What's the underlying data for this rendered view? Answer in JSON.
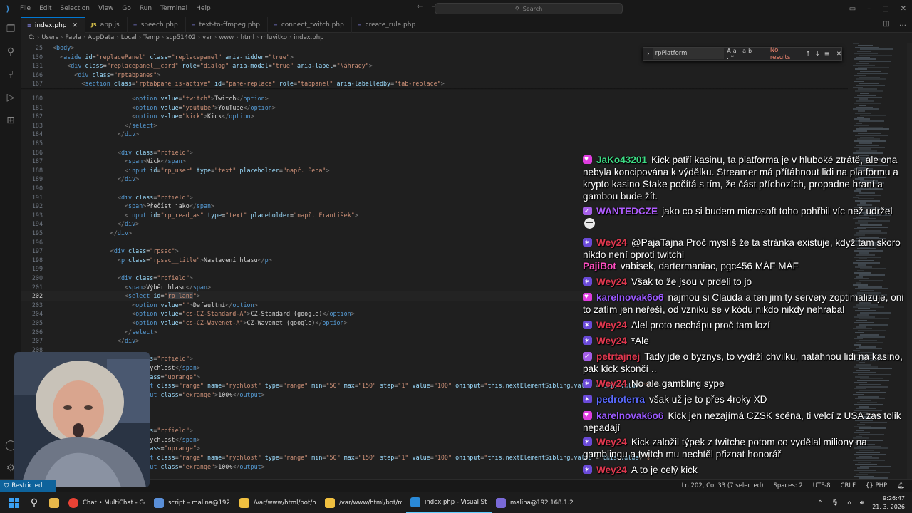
{
  "menu": [
    "File",
    "Edit",
    "Selection",
    "View",
    "Go",
    "Run",
    "Terminal",
    "Help"
  ],
  "search_placeholder": "Search",
  "tabs": [
    {
      "icon": "php",
      "label": "index.php",
      "active": true
    },
    {
      "icon": "js",
      "label": "app.js"
    },
    {
      "icon": "php",
      "label": "speech.php"
    },
    {
      "icon": "php",
      "label": "text-to-ffmpeg.php"
    },
    {
      "icon": "php",
      "label": "connect_twitch.php"
    },
    {
      "icon": "php",
      "label": "create_rule.php"
    }
  ],
  "breadcrumb": [
    "C:",
    "Users",
    "Pavla",
    "AppData",
    "Local",
    "Temp",
    "scp51402",
    "var",
    "www",
    "html",
    "mluvitko",
    "index.php"
  ],
  "find": {
    "query": "rpPlatform",
    "options": "Aa ab .*",
    "result": "No results"
  },
  "sticky": [
    {
      "n": "25",
      "indent": 0,
      "html": "<span class='p'>&lt;</span><span class='t'>body</span><span class='p'>&gt;</span>"
    },
    {
      "n": "130",
      "indent": 1,
      "html": "<span class='p'>&lt;</span><span class='t'>aside</span> <span class='a'>id</span><span class='x'>=</span><span class='s'>\"replacePanel\"</span> <span class='a'>class</span><span class='x'>=</span><span class='s'>\"replacepanel\"</span> <span class='a'>aria-hidden</span><span class='x'>=</span><span class='s'>\"true\"</span><span class='p'>&gt;</span>"
    },
    {
      "n": "131",
      "indent": 2,
      "html": "<span class='p'>&lt;</span><span class='t'>div</span> <span class='a'>class</span><span class='x'>=</span><span class='s'>\"replacepanel__card\"</span> <span class='a'>role</span><span class='x'>=</span><span class='s'>\"dialog\"</span> <span class='a'>aria-modal</span><span class='x'>=</span><span class='s'>\"true\"</span> <span class='a'>aria-label</span><span class='x'>=</span><span class='s'>\"Náhrady\"</span><span class='p'>&gt;</span>"
    },
    {
      "n": "166",
      "indent": 3,
      "html": "<span class='p'>&lt;</span><span class='t'>div</span> <span class='a'>class</span><span class='x'>=</span><span class='s'>\"rptabpanes\"</span><span class='p'>&gt;</span>"
    },
    {
      "n": "167",
      "indent": 4,
      "html": "<span class='p'>&lt;</span><span class='t'>section</span> <span class='a'>class</span><span class='x'>=</span><span class='s'>\"rptabpane is-active\"</span> <span class='a'>id</span><span class='x'>=</span><span class='s'>\"pane-replace\"</span> <span class='a'>role</span><span class='x'>=</span><span class='s'>\"tabpanel\"</span> <span class='a'>aria-labelledby</span><span class='x'>=</span><span class='s'>\"tab-replace\"</span><span class='p'>&gt;</span>"
    }
  ],
  "lines": [
    {
      "n": "180",
      "indent": 11,
      "html": "<span class='p'>&lt;</span><span class='t'>option</span> <span class='a'>value</span><span class='x'>=</span><span class='s'>\"twitch\"</span><span class='p'>&gt;</span><span class='x'>Twitch</span><span class='p'>&lt;/</span><span class='t'>option</span><span class='p'>&gt;</span>"
    },
    {
      "n": "181",
      "indent": 11,
      "html": "<span class='p'>&lt;</span><span class='t'>option</span> <span class='a'>value</span><span class='x'>=</span><span class='s'>\"youtube\"</span><span class='p'>&gt;</span><span class='x'>YouTube</span><span class='p'>&lt;/</span><span class='t'>option</span><span class='p'>&gt;</span>"
    },
    {
      "n": "182",
      "indent": 11,
      "html": "<span class='p'>&lt;</span><span class='t'>option</span> <span class='a'>value</span><span class='x'>=</span><span class='s'>\"kick\"</span><span class='p'>&gt;</span><span class='x'>Kick</span><span class='p'>&lt;/</span><span class='t'>option</span><span class='p'>&gt;</span>"
    },
    {
      "n": "183",
      "indent": 10,
      "html": "<span class='p'>&lt;/</span><span class='t'>select</span><span class='p'>&gt;</span>"
    },
    {
      "n": "184",
      "indent": 9,
      "html": "<span class='p'>&lt;/</span><span class='t'>div</span><span class='p'>&gt;</span>"
    },
    {
      "n": "185",
      "indent": 0,
      "html": ""
    },
    {
      "n": "186",
      "indent": 9,
      "html": "<span class='p'>&lt;</span><span class='t'>div</span> <span class='a'>class</span><span class='x'>=</span><span class='s'>\"rpfield\"</span><span class='p'>&gt;</span>"
    },
    {
      "n": "187",
      "indent": 10,
      "html": "<span class='p'>&lt;</span><span class='t'>span</span><span class='p'>&gt;</span><span class='x'>Nick</span><span class='p'>&lt;/</span><span class='t'>span</span><span class='p'>&gt;</span>"
    },
    {
      "n": "188",
      "indent": 10,
      "html": "<span class='p'>&lt;</span><span class='t'>input</span> <span class='a'>id</span><span class='x'>=</span><span class='s'>\"rp_user\"</span> <span class='a'>type</span><span class='x'>=</span><span class='s'>\"text\"</span> <span class='a'>placeholder</span><span class='x'>=</span><span class='s'>\"např. Pepa\"</span><span class='p'>&gt;</span>"
    },
    {
      "n": "189",
      "indent": 9,
      "html": "<span class='p'>&lt;/</span><span class='t'>div</span><span class='p'>&gt;</span>"
    },
    {
      "n": "190",
      "indent": 0,
      "html": ""
    },
    {
      "n": "191",
      "indent": 9,
      "html": "<span class='p'>&lt;</span><span class='t'>div</span> <span class='a'>class</span><span class='x'>=</span><span class='s'>\"rpfield\"</span><span class='p'>&gt;</span>"
    },
    {
      "n": "192",
      "indent": 10,
      "html": "<span class='p'>&lt;</span><span class='t'>span</span><span class='p'>&gt;</span><span class='x'>Přečíst jako</span><span class='p'>&lt;/</span><span class='t'>span</span><span class='p'>&gt;</span>"
    },
    {
      "n": "193",
      "indent": 10,
      "html": "<span class='p'>&lt;</span><span class='t'>input</span> <span class='a'>id</span><span class='x'>=</span><span class='s'>\"rp_read_as\"</span> <span class='a'>type</span><span class='x'>=</span><span class='s'>\"text\"</span> <span class='a'>placeholder</span><span class='x'>=</span><span class='s'>\"např. František\"</span><span class='p'>&gt;</span>"
    },
    {
      "n": "194",
      "indent": 9,
      "html": "<span class='p'>&lt;/</span><span class='t'>div</span><span class='p'>&gt;</span>"
    },
    {
      "n": "195",
      "indent": 8,
      "html": "<span class='p'>&lt;/</span><span class='t'>div</span><span class='p'>&gt;</span>"
    },
    {
      "n": "196",
      "indent": 0,
      "html": ""
    },
    {
      "n": "197",
      "indent": 8,
      "html": "<span class='p'>&lt;</span><span class='t'>div</span> <span class='a'>class</span><span class='x'>=</span><span class='s'>\"rpsec\"</span><span class='p'>&gt;</span>"
    },
    {
      "n": "198",
      "indent": 9,
      "html": "<span class='p'>&lt;</span><span class='t'>p</span> <span class='a'>class</span><span class='x'>=</span><span class='s'>\"rpsec__title\"</span><span class='p'>&gt;</span><span class='x'>Nastavení hlasu</span><span class='p'>&lt;/</span><span class='t'>p</span><span class='p'>&gt;</span>"
    },
    {
      "n": "199",
      "indent": 0,
      "html": ""
    },
    {
      "n": "200",
      "indent": 9,
      "html": "<span class='p'>&lt;</span><span class='t'>div</span> <span class='a'>class</span><span class='x'>=</span><span class='s'>\"rpfield\"</span><span class='p'>&gt;</span>"
    },
    {
      "n": "201",
      "indent": 10,
      "html": "<span class='p'>&lt;</span><span class='t'>span</span><span class='p'>&gt;</span><span class='x'>Výběr hlasu</span><span class='p'>&lt;/</span><span class='t'>span</span><span class='p'>&gt;</span>"
    },
    {
      "n": "202",
      "indent": 10,
      "cur": true,
      "html": "<span class='p'>&lt;</span><span class='t'>select</span> <span class='a'>id</span><span class='x'>=</span><span class='s'>\"<span class='hl'>rp_lang</span>\"</span><span class='p'>&gt;</span>"
    },
    {
      "n": "203",
      "indent": 11,
      "html": "<span class='p'>&lt;</span><span class='t'>option</span> <span class='a'>value</span><span class='x'>=</span><span class='s'>\"\"</span><span class='p'>&gt;</span><span class='x'>Defaultní</span><span class='p'>&lt;/</span><span class='t'>option</span><span class='p'>&gt;</span>"
    },
    {
      "n": "204",
      "indent": 11,
      "html": "<span class='p'>&lt;</span><span class='t'>option</span> <span class='a'>value</span><span class='x'>=</span><span class='s'>\"cs-CZ-Standard-A\"</span><span class='p'>&gt;</span><span class='x'>CZ-Standard (google)</span><span class='p'>&lt;/</span><span class='t'>option</span><span class='p'>&gt;</span>"
    },
    {
      "n": "205",
      "indent": 11,
      "html": "<span class='p'>&lt;</span><span class='t'>option</span> <span class='a'>value</span><span class='x'>=</span><span class='s'>\"cs-CZ-Wavenet-A\"</span><span class='p'>&gt;</span><span class='x'>CZ-Wavenet (google)</span><span class='p'>&lt;/</span><span class='t'>option</span><span class='p'>&gt;</span>"
    },
    {
      "n": "206",
      "indent": 10,
      "html": "<span class='p'>&lt;/</span><span class='t'>select</span><span class='p'>&gt;</span>"
    },
    {
      "n": "207",
      "indent": 9,
      "html": "<span class='p'>&lt;/</span><span class='t'>div</span><span class='p'>&gt;</span>"
    },
    {
      "n": "208",
      "indent": 0,
      "html": ""
    },
    {
      "n": "209",
      "indent": 9,
      "html": "<span class='p'>&lt;</span><span class='t'>div</span> <span class='a'>class</span><span class='x'>=</span><span class='s'>\"rpfield\"</span><span class='p'>&gt;</span>"
    },
    {
      "n": "210",
      "indent": 10,
      "html": "<span class='p'>&lt;</span><span class='t'>span</span><span class='p'>&gt;</span><span class='x'>Rychlost</span><span class='p'>&lt;/</span><span class='t'>span</span><span class='p'>&gt;</span>"
    },
    {
      "n": "211",
      "indent": 10,
      "html": "<span class='p'>&lt;</span><span class='t'>div</span> <span class='a'>class</span><span class='x'>=</span><span class='s'>\"uprange\"</span><span class='p'>&gt;</span>"
    },
    {
      "n": "212",
      "indent": 11,
      "html": "<span class='p'>&lt;</span><span class='t'>input</span> <span class='a'>class</span><span class='x'>=</span><span class='s'>\"range\"</span> <span class='a'>name</span><span class='x'>=</span><span class='s'>\"rychlost\"</span> <span class='a'>type</span><span class='x'>=</span><span class='s'>\"range\"</span> <span class='a'>min</span><span class='x'>=</span><span class='s'>\"50\"</span> <span class='a'>max</span><span class='x'>=</span><span class='s'>\"150\"</span> <span class='a'>step</span><span class='x'>=</span><span class='s'>\"1\"</span> <span class='a'>value</span><span class='x'>=</span><span class='s'>\"100\"</span> <span class='a'>oninput</span><span class='x'>=</span><span class='s'>\"</span><span class='a'>this</span><span class='x'>.</span><span class='a'>nextElementSibling</span><span class='x'>.</span><span class='a'>value</span> <span class='x'>=</span> <span class='a'>this</span><span class='x'>.</span><span class='a'>value</span><span class='x'>+</span><span class='s'>'%'</span><span class='s'>\"</span><span class='p'>&gt;</span>"
    },
    {
      "n": "213",
      "indent": 11,
      "html": "<span class='p'>&lt;</span><span class='t'>output</span> <span class='a'>class</span><span class='x'>=</span><span class='s'>\"exrange\"</span><span class='p'>&gt;</span><span class='x'>100%</span><span class='p'>&lt;/</span><span class='t'>output</span><span class='p'>&gt;</span>"
    },
    {
      "n": "214",
      "indent": 10,
      "html": "<span class='p'>&lt;/</span><span class='t'>div</span><span class='p'>&gt;</span>"
    },
    {
      "n": "215",
      "indent": 9,
      "html": "<span class='p'>&lt;/</span><span class='t'>div</span><span class='p'>&gt;</span>"
    },
    {
      "n": "216",
      "indent": 0,
      "html": ""
    },
    {
      "n": "217",
      "indent": 9,
      "html": "<span class='p'>&lt;</span><span class='t'>div</span> <span class='a'>class</span><span class='x'>=</span><span class='s'>\"rpfield\"</span><span class='p'>&gt;</span>"
    },
    {
      "n": "218",
      "indent": 10,
      "html": "<span class='p'>&lt;</span><span class='t'>span</span><span class='p'>&gt;</span><span class='x'>Rychlost</span><span class='p'>&lt;/</span><span class='t'>span</span><span class='p'>&gt;</span>"
    },
    {
      "n": "219",
      "indent": 10,
      "html": "<span class='p'>&lt;</span><span class='t'>div</span> <span class='a'>class</span><span class='x'>=</span><span class='s'>\"uprange\"</span><span class='p'>&gt;</span>"
    },
    {
      "n": "220",
      "indent": 11,
      "html": "<span class='p'>&lt;</span><span class='t'>input</span> <span class='a'>class</span><span class='x'>=</span><span class='s'>\"range\"</span> <span class='a'>name</span><span class='x'>=</span><span class='s'>\"rychlost\"</span> <span class='a'>type</span><span class='x'>=</span><span class='s'>\"range\"</span> <span class='a'>min</span><span class='x'>=</span><span class='s'>\"50\"</span> <span class='a'>max</span><span class='x'>=</span><span class='s'>\"150\"</span> <span class='a'>step</span><span class='x'>=</span><span class='s'>\"1\"</span> <span class='a'>value</span><span class='x'>=</span><span class='s'>\"100\"</span> <span class='a'>oninput</span><span class='x'>=</span><span class='s'>\"</span><span class='a'>this</span><span class='x'>.</span><span class='a'>nextElementSibling</span><span class='x'>.</span><span class='a'>value</span> <span class='x'>=</span> <span class='a'>this</span><span class='x'>.</span><span class='a'>value</span><span class='x'>+</span><span class='s'>'%'</span><span class='s'>\"</span><span class='p'>&gt;</span>"
    },
    {
      "n": "221",
      "indent": 11,
      "html": "<span class='p'>&lt;</span><span class='t'>output</span> <span class='a'>class</span><span class='x'>=</span><span class='s'>\"exrange\"</span><span class='p'>&gt;</span><span class='x'>100%</span><span class='p'>&lt;/</span><span class='t'>output</span><span class='p'>&gt;</span>"
    }
  ],
  "chat": [
    {
      "badge": "heart",
      "nick": "JaKo43201",
      "color": "#3ddc84",
      "text": "Kick patří kasinu, ta platforma je v hluboké ztrátě, ale ona nebyla koncipována k výdělku. Streamer má přítáhnout lidi na platformu a krypto kasino Stake počítá s tím, že část příchozích, propadne hraní a gambou bude žít."
    },
    {
      "badge": "verify",
      "nick": "WANTEDCZE",
      "color": "#b05cff",
      "text": "jako co si budem microsoft toho pohřbil víc než udržel",
      "emotes": 1
    },
    {
      "badge": "lvl",
      "nick": "Wey24",
      "color": "#e0384f",
      "text": "@PajaTajna Proč myslíš že ta stránka existuje, když tam skoro nikdo není oproti twitchi"
    },
    {
      "badge": "",
      "nick": "PajiBot",
      "color": "#ff4fc1",
      "text": "vabisek, dartermaniac, pgc456 MÁF MÁF"
    },
    {
      "badge": "lvl",
      "nick": "Wey24",
      "color": "#e0384f",
      "text": "Však to že jsou v prdeli to jo"
    },
    {
      "badge": "heart",
      "nick": "karelnovak6o6",
      "color": "#9b59ff",
      "text": "najmou si Clauda a ten jim ty servery zoptimalizuje, oni to zatím jen neřeší, od vzniku se v kódu nikdo nikdy nehrabal"
    },
    {
      "badge": "lvl",
      "nick": "Wey24",
      "color": "#e0384f",
      "text": "Alel proto nechápu proč tam lozí"
    },
    {
      "badge": "lvl",
      "nick": "Wey24",
      "color": "#e0384f",
      "text": "*Ale"
    },
    {
      "badge": "verify",
      "nick": "petrtajnej",
      "color": "#e0384f",
      "text": "Tady jde o byznys, to vydrží chvilku, natáhnou lidi na kasino, pak kick skončí .."
    },
    {
      "badge": "lvl",
      "nick": "Wey24",
      "color": "#e0384f",
      "text": "No ale gambling sype"
    },
    {
      "badge": "lvl",
      "nick": "pedroterra",
      "color": "#5b6bff",
      "text": "však už je to přes 4roky XD"
    },
    {
      "badge": "heart",
      "nick": "karelnovak6o6",
      "color": "#9b59ff",
      "text": "Kick jen nezajímá CZSK scéna, ti velcí z USA zas tolik nepadají"
    },
    {
      "badge": "lvl",
      "nick": "Wey24",
      "color": "#e0384f",
      "text": "Kick založil týpek z twitche potom co vydělal miliony na gamblingu a twitch mu nechtěl přiznat honorář"
    },
    {
      "badge": "lvl",
      "nick": "Wey24",
      "color": "#e0384f",
      "text": "A to je celý kick"
    },
    {
      "badge": "verify",
      "nick": "petrtajnej",
      "color": "#e0384f",
      "text": "",
      "emotes": 2
    }
  ],
  "status": {
    "remote": "Restricted",
    "position": "Ln 202, Col 33 (7 selected)",
    "spaces": "Spaces: 2",
    "encoding": "UTF-8",
    "eol": "CRLF",
    "language": "{} PHP"
  },
  "taskbar": {
    "apps": [
      {
        "label": "Chat • MultiChat - Goog",
        "icon": "chrome",
        "color": "#e94235"
      },
      {
        "label": "script – malina@192.168",
        "icon": "terminal",
        "color": "#5a8fd8"
      },
      {
        "label": "/var/www/html/bot/mlu",
        "icon": "file",
        "color": "#f0c040"
      },
      {
        "label": "/var/www/html/bot/mlu",
        "icon": "file",
        "color": "#f0c040"
      },
      {
        "label": "index.php - Visual Studi",
        "icon": "vscode",
        "color": "#2a8ad8",
        "active": true
      },
      {
        "label": "malina@192.168.1.200",
        "icon": "putty",
        "color": "#7a6ad8"
      }
    ],
    "time": "9:26:47",
    "date": "21. 3. 2026"
  }
}
